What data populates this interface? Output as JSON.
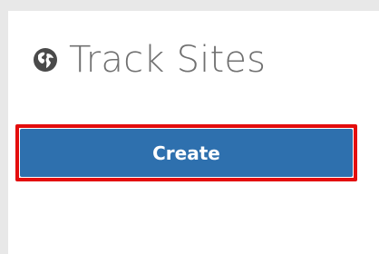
{
  "header": {
    "title": "Track Sites",
    "icon": "globe-icon"
  },
  "actions": {
    "create_label": "Create"
  },
  "colors": {
    "accent": "#2e70ae",
    "highlight": "#e30d0d",
    "title_text": "#707070"
  }
}
